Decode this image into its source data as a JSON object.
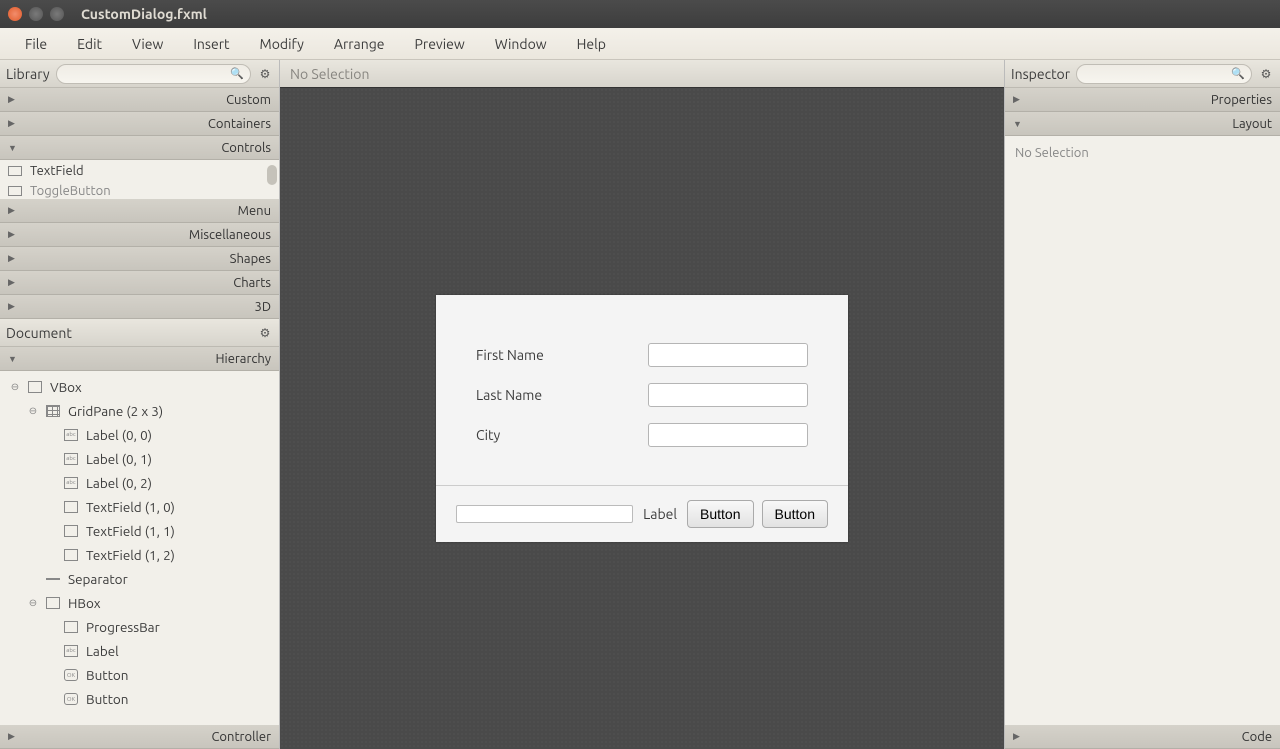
{
  "window": {
    "title": "CustomDialog.fxml"
  },
  "menubar": [
    "File",
    "Edit",
    "View",
    "Insert",
    "Modify",
    "Arrange",
    "Preview",
    "Window",
    "Help"
  ],
  "library": {
    "title": "Library",
    "sections": {
      "custom": "Custom",
      "containers": "Containers",
      "controls": "Controls",
      "menu": "Menu",
      "misc": "Miscellaneous",
      "shapes": "Shapes",
      "charts": "Charts",
      "threeD": "3D"
    },
    "controls_visible": [
      "TextField",
      "ToggleButton"
    ]
  },
  "document": {
    "title": "Document",
    "hierarchy": "Hierarchy",
    "controller": "Controller",
    "tree": [
      {
        "d": 0,
        "exp": "⊖",
        "icon": "vbox",
        "label": "VBox"
      },
      {
        "d": 1,
        "exp": "⊖",
        "icon": "grid",
        "label": "GridPane (2 x 3)"
      },
      {
        "d": 2,
        "exp": "",
        "icon": "label",
        "label": "Label (0, 0)"
      },
      {
        "d": 2,
        "exp": "",
        "icon": "label",
        "label": "Label (0, 1)"
      },
      {
        "d": 2,
        "exp": "",
        "icon": "label",
        "label": "Label (0, 2)"
      },
      {
        "d": 2,
        "exp": "",
        "icon": "tf",
        "label": "TextField (1, 0)"
      },
      {
        "d": 2,
        "exp": "",
        "icon": "tf",
        "label": "TextField (1, 1)"
      },
      {
        "d": 2,
        "exp": "",
        "icon": "tf",
        "label": "TextField (1, 2)"
      },
      {
        "d": 1,
        "exp": "",
        "icon": "sep",
        "label": "Separator"
      },
      {
        "d": 1,
        "exp": "⊖",
        "icon": "hbox",
        "label": "HBox"
      },
      {
        "d": 2,
        "exp": "",
        "icon": "tf",
        "label": "ProgressBar"
      },
      {
        "d": 2,
        "exp": "",
        "icon": "label",
        "label": "Label"
      },
      {
        "d": 2,
        "exp": "",
        "icon": "ok",
        "label": "Button"
      },
      {
        "d": 2,
        "exp": "",
        "icon": "ok",
        "label": "Button"
      }
    ]
  },
  "center": {
    "selection": "No Selection",
    "form": {
      "row1": "First Name",
      "row2": "Last Name",
      "row3": "City",
      "label": "Label",
      "btn1": "Button",
      "btn2": "Button"
    }
  },
  "inspector": {
    "title": "Inspector",
    "properties": "Properties",
    "layout": "Layout",
    "code": "Code",
    "body": "No Selection"
  }
}
